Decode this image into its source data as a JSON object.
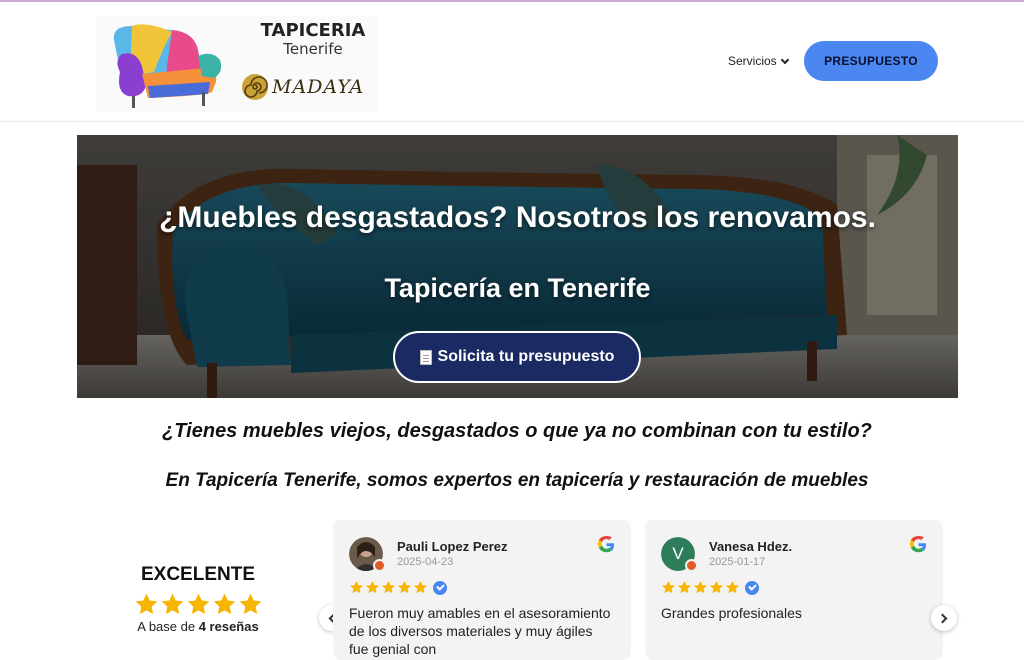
{
  "header": {
    "logo": {
      "line1": "TAPICERIA",
      "line2": "Tenerife",
      "partner": "MADAYA"
    },
    "nav": {
      "services_label": "Servicios"
    },
    "cta_label": "PRESUPUESTO"
  },
  "hero": {
    "title": "¿Muebles desgastados? Nosotros los renovamos.",
    "subtitle": "Tapicería en Tenerife",
    "button_label": "Solicita tu presupuesto"
  },
  "intro": {
    "question": "¿Tienes muebles viejos, desgastados o que ya no combinan con tu estilo?",
    "statement": "En Tapicería Tenerife, somos expertos en tapicería y restauración de muebles"
  },
  "reviews": {
    "summary": {
      "rating_word": "EXCELENTE",
      "stars": 5,
      "based_prefix": "A base de",
      "based_count": "4 reseñas"
    },
    "items": [
      {
        "name": "Pauli Lopez Perez",
        "date": "2025-04-23",
        "stars": 5,
        "text": "Fueron muy amables en el asesoramiento de los diversos materiales y muy ágiles fue genial con"
      },
      {
        "name": "Vanesa Hdez.",
        "initial": "V",
        "date": "2025-01-17",
        "stars": 5,
        "text": "Grandes profesionales"
      }
    ]
  },
  "colors": {
    "accent": "#4a87f0",
    "hero_button": "#1c2a63",
    "star": "#f7b500",
    "card_bg": "#f3f3f3"
  }
}
